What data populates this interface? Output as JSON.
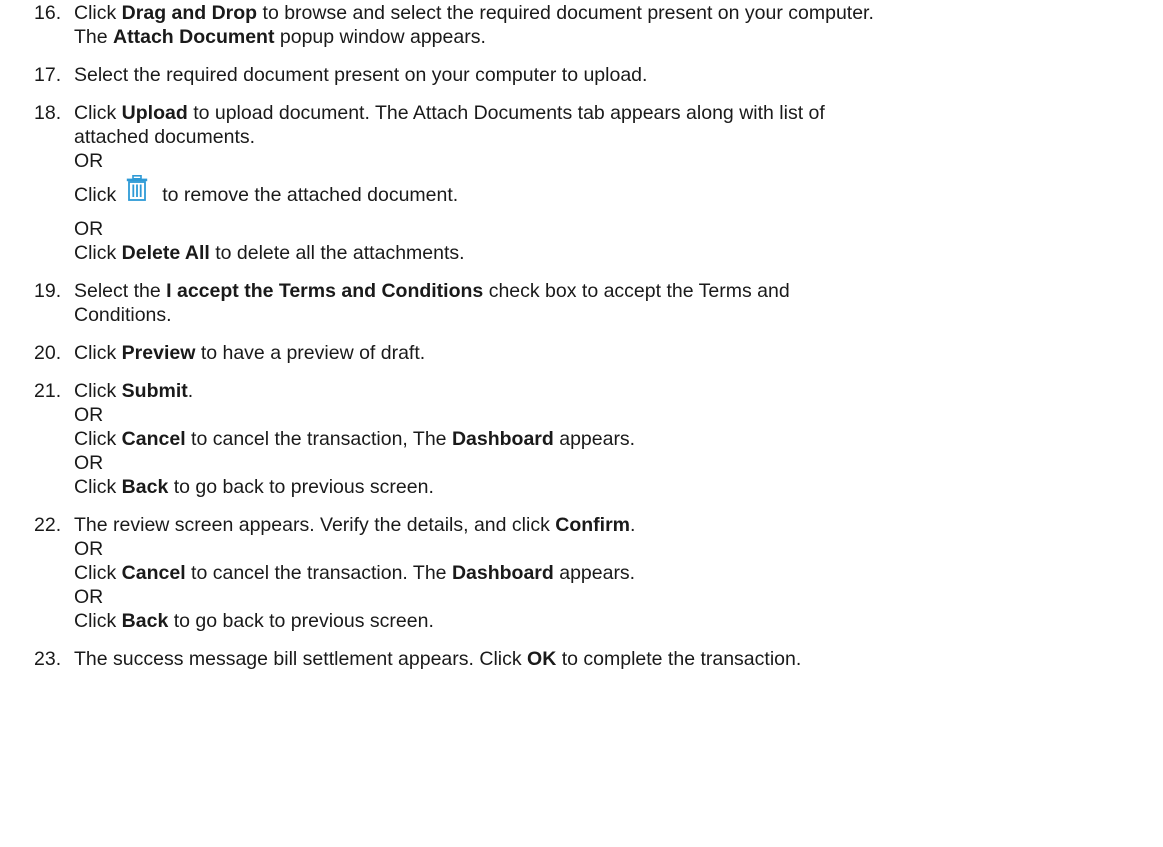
{
  "steps": [
    {
      "num": "16.",
      "drag_click": "Click",
      "drag_label": "Drag and Drop",
      "drag_rest": "to browse and select the required document present on your computer.",
      "popup_pre": "The",
      "popup_label": "Attach Document",
      "popup_rest": "popup window appears."
    },
    {
      "num": "17.",
      "text": "Select the required document present on your computer to upload."
    },
    {
      "num": "18.",
      "upload_click": "Click",
      "upload_label": "Upload",
      "upload_rest": "to upload document. The Attach Documents tab appears along with list of",
      "upload_line2": "attached documents.",
      "or1": "OR",
      "trash_pre": "Click",
      "trash_icon": "trash-icon",
      "trash_rest": "to remove the attached document.",
      "or2": "OR",
      "deleteall_click": "Click",
      "deleteall_label": "Delete All",
      "deleteall_rest": "to delete all the attachments."
    },
    {
      "num": "19.",
      "pre": "Select the",
      "label": "I accept the Terms and Conditions",
      "rest": "check box to accept the Terms and",
      "line2": "Conditions."
    },
    {
      "num": "20.",
      "pre": "Click",
      "label": "Preview",
      "rest": "to have a preview of draft."
    },
    {
      "num": "21.",
      "submit_click": "Click",
      "submit_label": "Submit",
      "submit_rest": ".",
      "or1": "OR",
      "cancel_click": "Click",
      "cancel_label": "Cancel",
      "cancel_mid": "to cancel the transaction, The",
      "cancel_dash": "Dashboard",
      "cancel_rest": "appears.",
      "or2": "OR",
      "back_click": "Click",
      "back_label": "Back",
      "back_rest": "to go back to previous screen."
    },
    {
      "num": "22.",
      "review_pre": "The review screen appears. Verify the details, and click",
      "confirm_label": "Confirm",
      "confirm_rest": ".",
      "or1": "OR",
      "cancel_click": "Click",
      "cancel_label": "Cancel",
      "cancel_mid": "to cancel the transaction. The",
      "cancel_dash": "Dashboard",
      "cancel_rest": "appears.",
      "or2": "OR",
      "back_click": "Click",
      "back_label": "Back",
      "back_rest": "to go back to previous screen."
    },
    {
      "num": "23.",
      "pre": "The success message bill settlement appears. Click",
      "label": "OK",
      "rest": "to complete the transaction."
    }
  ],
  "colors": {
    "text": "#1a1a1a",
    "trash_icon": "#2e9ad6"
  }
}
